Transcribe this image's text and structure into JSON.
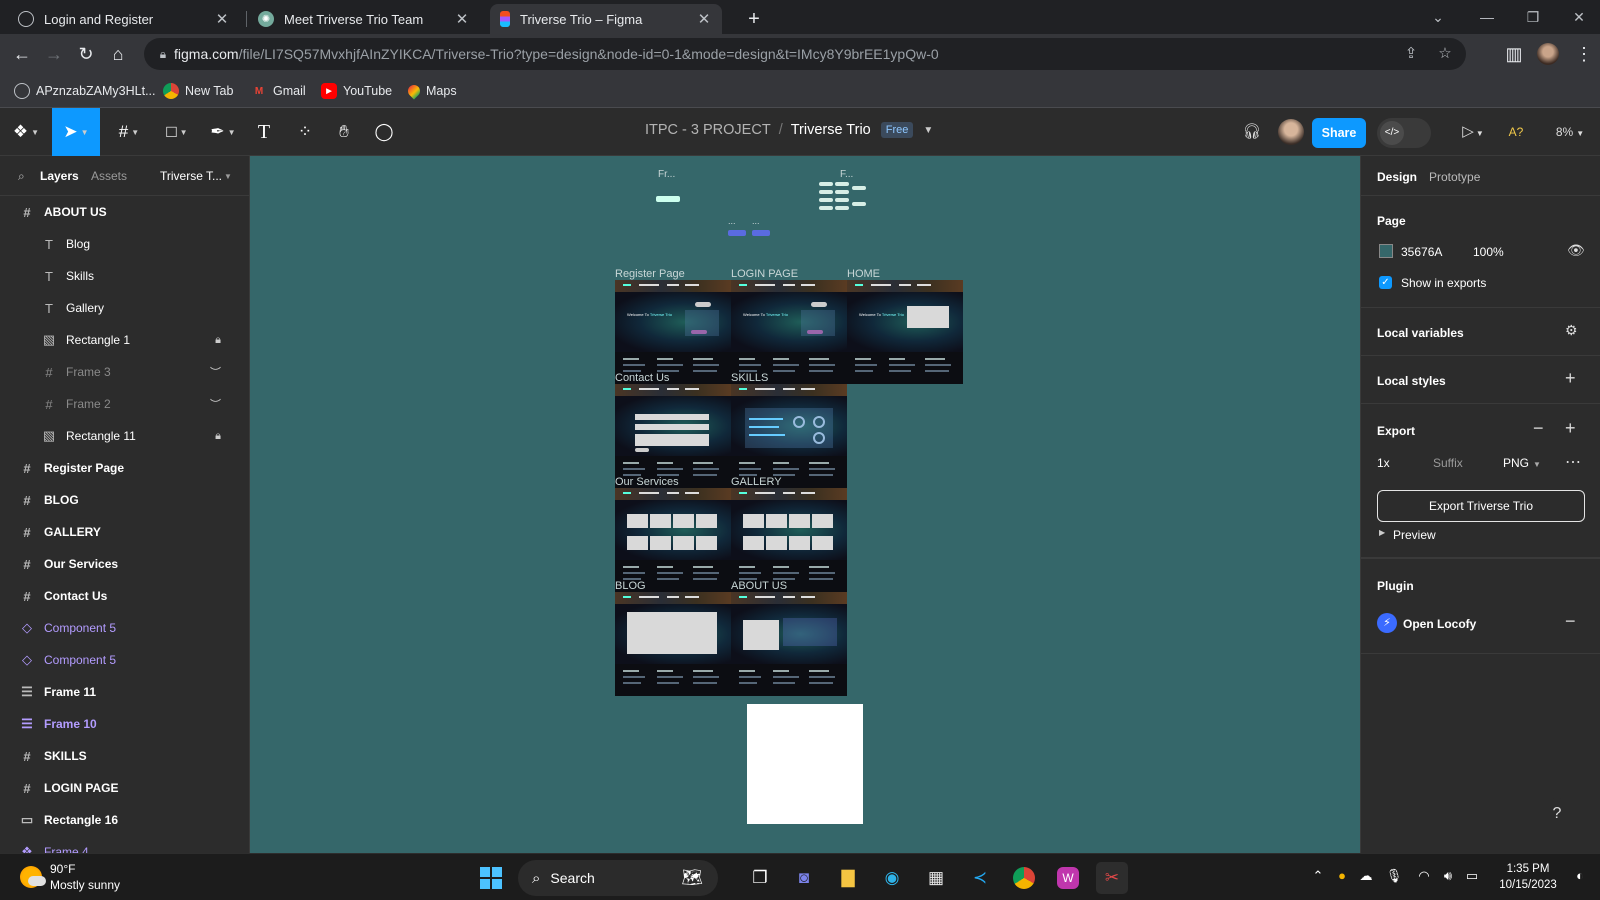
{
  "browser": {
    "tabs": [
      {
        "label": "Login and Register",
        "icon": "globe-icon",
        "active": false
      },
      {
        "label": "Meet Triverse Trio Team",
        "icon": "chatgpt-icon",
        "active": false
      },
      {
        "label": "Triverse Trio – Figma",
        "icon": "figma-icon",
        "active": true
      }
    ],
    "url_host": "figma.com",
    "url_path": "/file/LI7SQ57MvxhjfAInZYIKCA/Triverse-Trio?type=design&node-id=0-1&mode=design&t=IMcy8Y9brEE1ypQw-0",
    "bookmarks": [
      {
        "label": "APznzabZAMy3HLt...",
        "icon": "bookmark-globe-icon"
      },
      {
        "label": "New Tab",
        "icon": "chrome-icon"
      },
      {
        "label": "Gmail",
        "icon": "gmail-icon"
      },
      {
        "label": "YouTube",
        "icon": "youtube-icon"
      },
      {
        "label": "Maps",
        "icon": "maps-icon"
      }
    ]
  },
  "figma": {
    "project": "ITPC - 3 PROJECT",
    "file_name": "Triverse Trio",
    "plan_badge": "Free",
    "share_label": "Share",
    "zoom": "8%",
    "left_tabs": {
      "layers": "Layers",
      "assets": "Assets",
      "page": "Triverse T..."
    },
    "layers": [
      {
        "name": "ABOUT US",
        "icon": "#",
        "kind": "top"
      },
      {
        "name": "Blog",
        "icon": "T",
        "kind": "child"
      },
      {
        "name": "Skills",
        "icon": "T",
        "kind": "child"
      },
      {
        "name": "Gallery",
        "icon": "T",
        "kind": "child"
      },
      {
        "name": "Rectangle 1",
        "icon": "▧",
        "kind": "child",
        "state": "lock"
      },
      {
        "name": "Frame 3",
        "icon": "#",
        "kind": "dim",
        "state": "hidden"
      },
      {
        "name": "Frame 2",
        "icon": "#",
        "kind": "dim",
        "state": "hidden"
      },
      {
        "name": "Rectangle 11",
        "icon": "▧",
        "kind": "child",
        "state": "lock"
      },
      {
        "name": "Register Page",
        "icon": "#",
        "kind": "top"
      },
      {
        "name": "BLOG",
        "icon": "#",
        "kind": "top"
      },
      {
        "name": "GALLERY",
        "icon": "#",
        "kind": "top"
      },
      {
        "name": "Our Services",
        "icon": "#",
        "kind": "top"
      },
      {
        "name": "Contact Us",
        "icon": "#",
        "kind": "top"
      },
      {
        "name": "Component 5",
        "icon": "◇",
        "kind": "purple"
      },
      {
        "name": "Component 5",
        "icon": "◇",
        "kind": "purple"
      },
      {
        "name": "Frame 11",
        "icon": "☰",
        "kind": "top"
      },
      {
        "name": "Frame 10",
        "icon": "☰",
        "kind": "topp"
      },
      {
        "name": "SKILLS",
        "icon": "#",
        "kind": "top"
      },
      {
        "name": "LOGIN PAGE",
        "icon": "#",
        "kind": "top"
      },
      {
        "name": "Rectangle 16",
        "icon": "▭",
        "kind": "top"
      },
      {
        "name": "Frame 4",
        "icon": "❖",
        "kind": "purple"
      }
    ],
    "canvas": {
      "background": "#35676A",
      "frames": [
        {
          "label": "Register Page",
          "kind": "register"
        },
        {
          "label": "LOGIN PAGE",
          "kind": "login"
        },
        {
          "label": "HOME",
          "kind": "home"
        },
        {
          "label": "Contact Us",
          "kind": "contact"
        },
        {
          "label": "SKILLS",
          "kind": "skills"
        },
        {
          "label": "Our Services",
          "kind": "grid"
        },
        {
          "label": "GALLERY",
          "kind": "grid"
        },
        {
          "label": "BLOG",
          "kind": "blog"
        },
        {
          "label": "ABOUT US",
          "kind": "about"
        }
      ],
      "small_labels": [
        "Fr...",
        "F...",
        "...",
        "...",
        "..."
      ]
    },
    "right": {
      "tabs": {
        "design": "Design",
        "prototype": "Prototype"
      },
      "page_title": "Page",
      "page_color": "35676A",
      "page_opacity": "100%",
      "show_in_exports": "Show in exports",
      "local_variables": "Local variables",
      "local_styles": "Local styles",
      "export_title": "Export",
      "export_scale": "1x",
      "export_suffix_placeholder": "Suffix",
      "export_format": "PNG",
      "export_button": "Export Triverse Trio",
      "preview": "Preview",
      "plugin_title": "Plugin",
      "plugin_name": "Open Locofy"
    }
  },
  "taskbar": {
    "weather_temp": "90°F",
    "weather_desc": "Mostly sunny",
    "search_label": "Search",
    "time": "1:35 PM",
    "date": "10/15/2023"
  }
}
